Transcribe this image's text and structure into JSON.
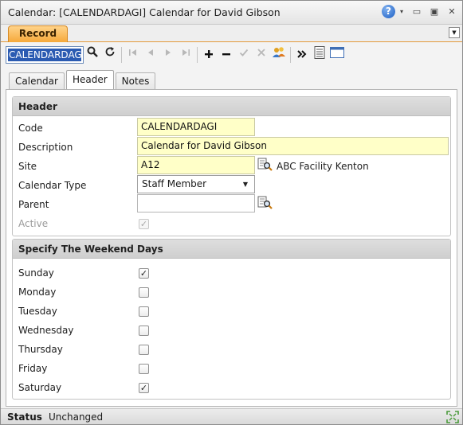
{
  "window": {
    "title": "Calendar: [CALENDARDAGI] Calendar for David Gibson",
    "help_label": "?",
    "menu_caret": "▾",
    "minimize": "▭",
    "maximize": "▣",
    "close": "✕"
  },
  "tabs": {
    "record_label": "Record",
    "dropdown_caret": "▼"
  },
  "toolbar": {
    "search_value": "CALENDARDAGI",
    "buttons": [
      {
        "name": "search-icon",
        "glyph": "🔍"
      },
      {
        "name": "refresh-icon",
        "glyph": "↻"
      },
      {
        "name": "first-record-icon",
        "glyph": "|◀"
      },
      {
        "name": "previous-record-icon",
        "glyph": "◀"
      },
      {
        "name": "next-record-icon",
        "glyph": "▶"
      },
      {
        "name": "last-record-icon",
        "glyph": "▶|"
      },
      {
        "name": "add-icon",
        "glyph": "+"
      },
      {
        "name": "remove-icon",
        "glyph": "−"
      },
      {
        "name": "save-check-icon",
        "glyph": "✓"
      },
      {
        "name": "cancel-x-icon",
        "glyph": "✕"
      },
      {
        "name": "users-icon",
        "glyph": "👥"
      },
      {
        "name": "more-actions-icon",
        "glyph": "»"
      },
      {
        "name": "list-view-icon",
        "glyph": "☰"
      },
      {
        "name": "form-view-icon",
        "glyph": "▭"
      }
    ]
  },
  "subtabs": [
    "Calendar",
    "Header",
    "Notes"
  ],
  "header_section": {
    "title": "Header",
    "code_label": "Code",
    "code_value": "CALENDARDAGI",
    "description_label": "Description",
    "description_value": "Calendar for David Gibson",
    "site_label": "Site",
    "site_value": "A12",
    "site_description": "ABC Facility Kenton",
    "calendar_type_label": "Calendar Type",
    "calendar_type_value": "Staff Member",
    "parent_label": "Parent",
    "parent_value": "",
    "active_label": "Active",
    "active_checked": true
  },
  "weekend_section": {
    "title": "Specify The Weekend Days",
    "days": [
      {
        "label": "Sunday",
        "checked": true
      },
      {
        "label": "Monday",
        "checked": false
      },
      {
        "label": "Tuesday",
        "checked": false
      },
      {
        "label": "Wednesday",
        "checked": false
      },
      {
        "label": "Thursday",
        "checked": false
      },
      {
        "label": "Friday",
        "checked": false
      },
      {
        "label": "Saturday",
        "checked": true
      }
    ]
  },
  "status": {
    "label": "Status",
    "value": "Unchanged"
  },
  "colors": {
    "accent_tab": "#f6a93a",
    "required_field": "#ffffc8",
    "selection": "#2b5bb2"
  }
}
